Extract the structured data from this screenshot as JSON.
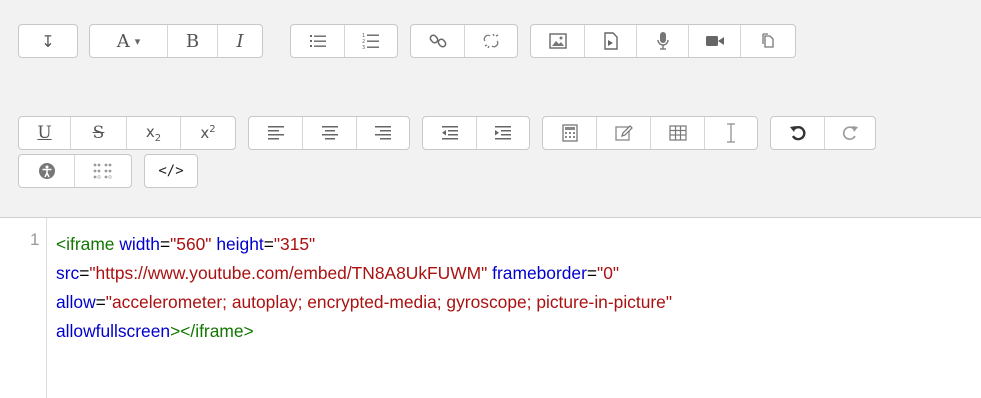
{
  "toolbar": {
    "row1": {
      "collapse": "↧",
      "font_color": "A",
      "font_color_arrow": "▾",
      "bold": "B",
      "italic": "I"
    },
    "row2": {
      "underline": "U",
      "strike": "S",
      "subscript_base": "x",
      "subscript_mark": "2",
      "superscript_base": "x",
      "superscript_mark": "2"
    },
    "row3": {
      "html_toggle": "</>"
    }
  },
  "editor": {
    "line_number": "1",
    "line1": {
      "open": "<iframe",
      "a1": "width",
      "eq1": "=",
      "v1": "\"560\"",
      "a2": "height",
      "eq2": "=",
      "v2": "\"315\""
    },
    "line2": {
      "a3": "src",
      "eq3": "=",
      "v3": "\"https://www.youtube.com/embed/TN8A8UkFUWM\"",
      "a4": "frameborder",
      "eq4": "=",
      "v4": "\"0\""
    },
    "line3": {
      "a5": "allow",
      "eq5": "=",
      "v5": "\"accelerometer; autoplay; encrypted-media; gyroscope; picture-in-picture\""
    },
    "line4": {
      "a6": "allowfullscreen",
      "gt": ">",
      "close": "</iframe>"
    }
  }
}
